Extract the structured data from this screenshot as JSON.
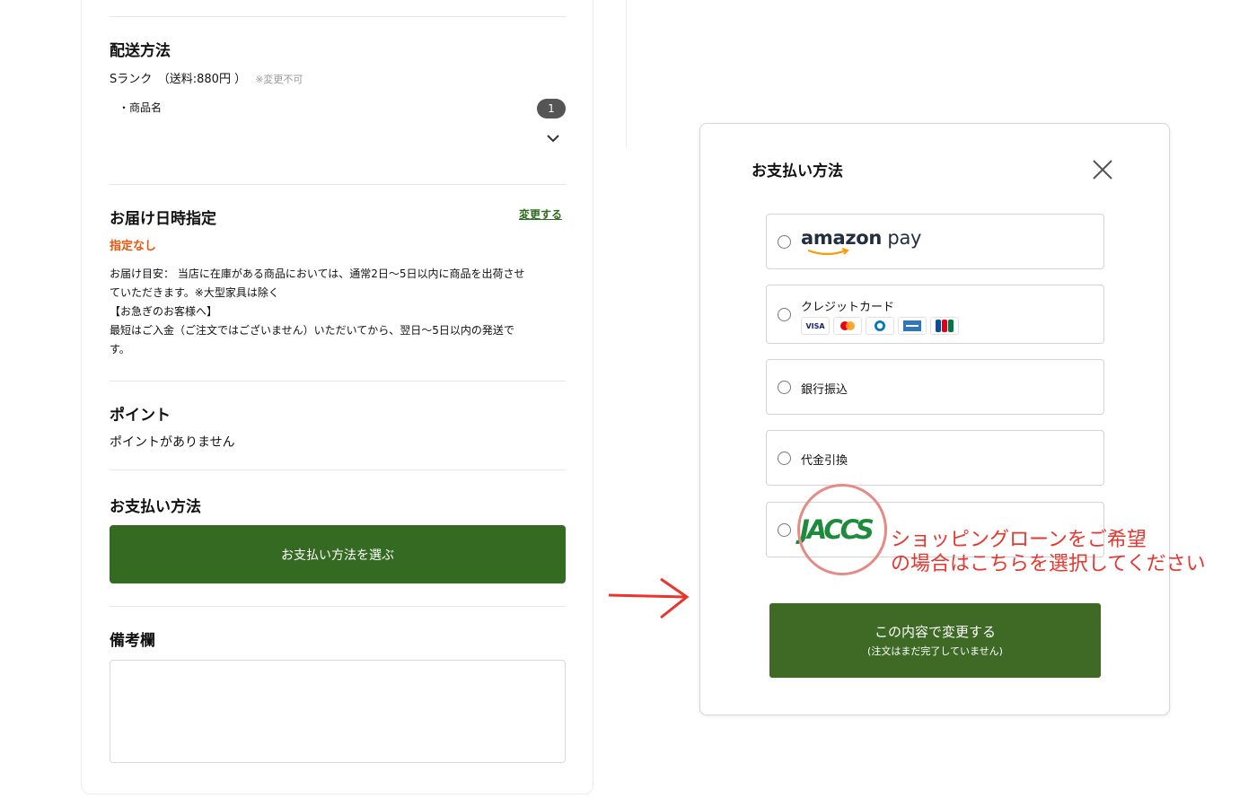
{
  "delivery": {
    "title": "配送方法",
    "rank": "Sランク　（送料:880円 ）",
    "rank_note": "※変更不可",
    "item_label": "・商品名",
    "item_count": "1"
  },
  "delivery_time": {
    "title": "お届け日時指定",
    "change_link": "変更する",
    "status": "指定なし",
    "note_lines": [
      "お届け目安： 当店に在庫がある商品においては、通常2日〜5日以内に商品を出荷させ",
      "ていただきます。※大型家具は除く",
      "【お急ぎのお客様へ】",
      "最短はご入金（ご注文ではございません）いただいてから、翌日〜5日以内の発送で",
      "す。"
    ]
  },
  "points": {
    "title": "ポイント",
    "status": "ポイントがありません"
  },
  "payment": {
    "title": "お支払い方法",
    "button": "お支払い方法を選ぶ"
  },
  "remarks": {
    "title": "備考欄"
  },
  "modal": {
    "title": "お支払い方法",
    "options": [
      {
        "label": "amazon pay",
        "logo_prefix": "amazon",
        "logo_suffix": "pay"
      },
      {
        "label": "クレジットカード",
        "cards": [
          "VISA",
          "Mastercard",
          "Diners",
          "AMEX",
          "JCB"
        ]
      },
      {
        "label": "銀行振込"
      },
      {
        "label": "代金引換"
      },
      {
        "label": "JACCS",
        "logo_text": "JACCS"
      }
    ],
    "submit_main": "この内容で変更する",
    "submit_sub": "(注文はまだ完了していません)"
  },
  "annotation": {
    "line1": "ショッピングローンをご希望",
    "line2": "の場合はこちらを選択してください"
  },
  "colors": {
    "primary_green": "#356a23",
    "accent_orange": "#e8580c",
    "annotation_red": "#e8352d"
  }
}
